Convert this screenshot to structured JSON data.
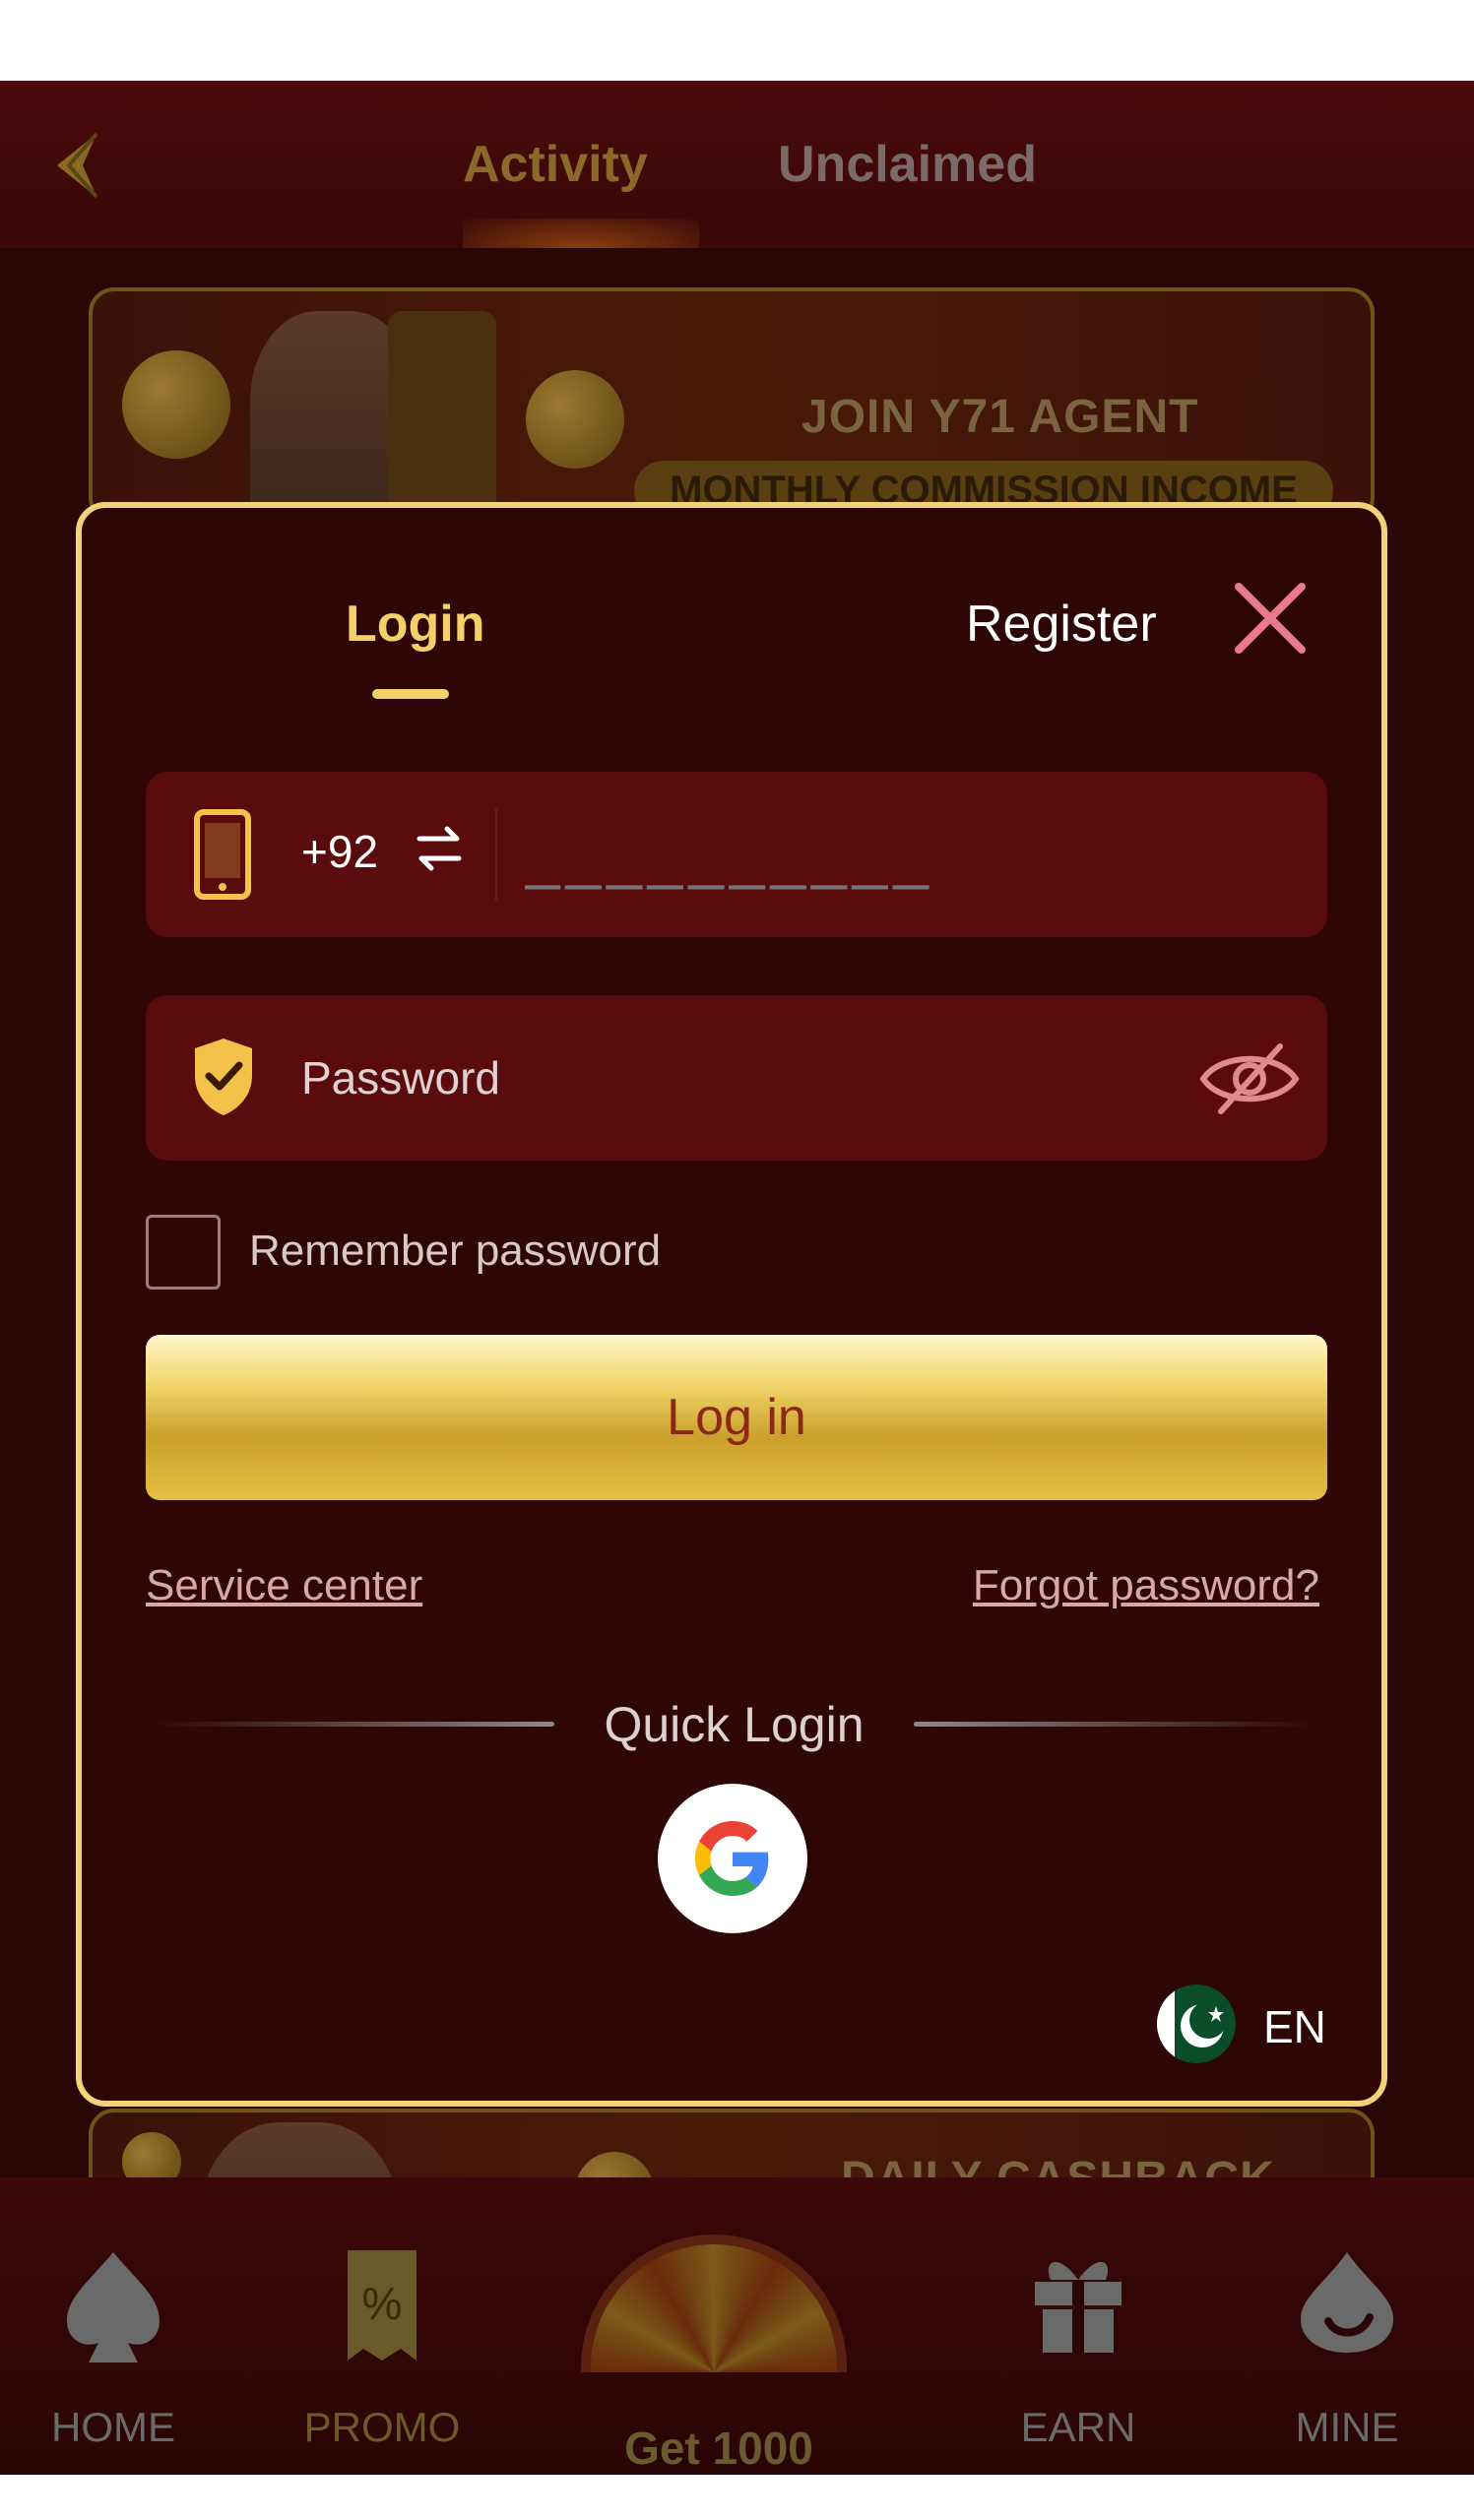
{
  "header": {
    "tabs": [
      {
        "label": "Activity"
      },
      {
        "label": "Unclaimed"
      }
    ]
  },
  "banners": {
    "top": {
      "title": "JOIN Y71 AGENT",
      "subtitle": "MONTHLY COMMISSION INCOME"
    },
    "bottom": {
      "title": "DAILY CASHBACK"
    }
  },
  "modal": {
    "tabs": {
      "login": "Login",
      "register": "Register"
    },
    "phone": {
      "country_code": "+92",
      "placeholder": "__________"
    },
    "password": {
      "placeholder": "Password"
    },
    "remember_label": "Remember password",
    "login_button": "Log in",
    "links": {
      "service": "Service center",
      "forgot": "Forgot password?"
    },
    "quick_login": "Quick Login",
    "language": "EN"
  },
  "bottom_nav": {
    "items": [
      {
        "label": "HOME"
      },
      {
        "label": "PROMO"
      },
      {
        "label": "EARN"
      },
      {
        "label": "MINE"
      }
    ],
    "center": {
      "label": "Get 1000"
    }
  },
  "colors": {
    "accent": "#f5cf6a",
    "modal_bg": "#2e0606",
    "field_bg": "#5a0c0c",
    "close": "#e87a8a"
  }
}
